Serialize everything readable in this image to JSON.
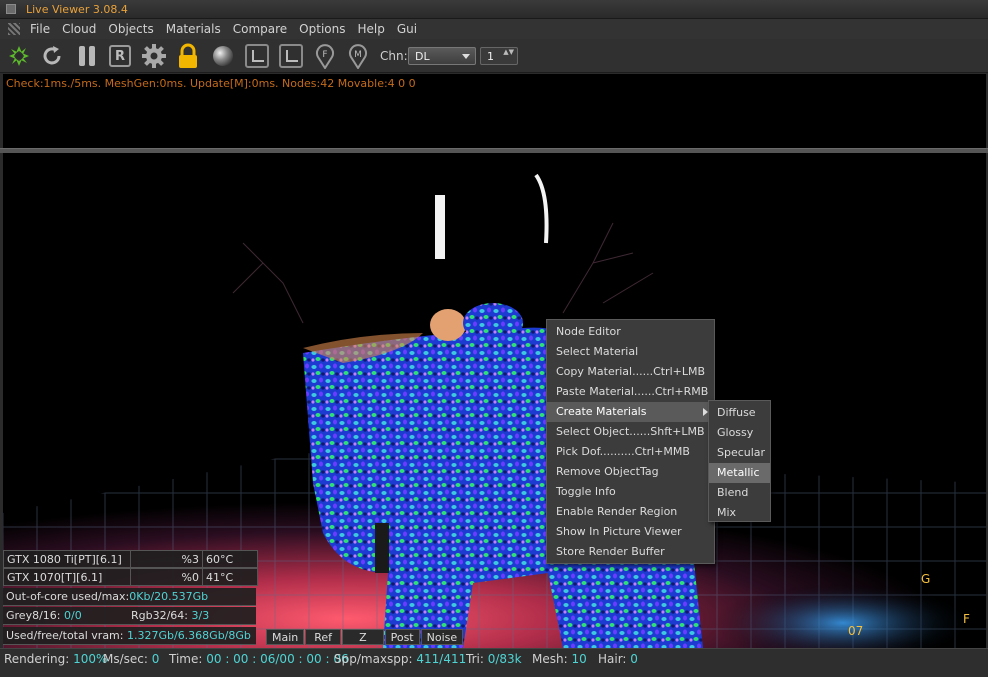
{
  "window": {
    "title": "Live Viewer 3.08.4"
  },
  "menu": [
    "File",
    "Cloud",
    "Objects",
    "Materials",
    "Compare",
    "Options",
    "Help",
    "Gui"
  ],
  "toolbar": {
    "icons": [
      "octane-logo-icon",
      "refresh-icon",
      "pause-icon",
      "restart-icon",
      "gear-icon",
      "lock-icon",
      "material-sphere-icon",
      "region-icon",
      "film-region-icon",
      "focus-pin-icon",
      "material-pin-icon"
    ],
    "restart_glyph": "R",
    "focus_glyph": "F",
    "material_glyph": "M",
    "chn_label": "Chn:",
    "chn_value": "DL",
    "spin_value": "1",
    "spin_glyph": "▲▼",
    "accent": "#e9a23b",
    "octane_green": "#5dbb2b"
  },
  "info": {
    "stats": "Check:1ms./5ms. MeshGen:0ms. Update[M]:0ms. Nodes:42 Movable:4  0 0"
  },
  "gpus": [
    {
      "name": "GTX 1080 Ti[PT][6.1]",
      "usage": "%3",
      "temp": "60°C"
    },
    {
      "name": "GTX 1070[T][6.1]",
      "usage": "%0",
      "temp": "41°C"
    }
  ],
  "overlay": {
    "ooc_label": "Out-of-core used/max:",
    "ooc_value": "0Kb/20.537Gb",
    "grey_label": "Grey8/16: ",
    "grey_value": "0/0",
    "rgb_label": "Rgb32/64: ",
    "rgb_value": "3/3",
    "vram_label": "Used/free/total vram: ",
    "vram_value": "1.327Gb/6.368Gb/8Gb"
  },
  "tabs": [
    "Main",
    "Ref",
    "Z",
    "Post",
    "Noise"
  ],
  "context_menu": [
    "Node Editor",
    "Select Material",
    "Copy Material......Ctrl+LMB",
    "Paste Material......Ctrl+RMB",
    "Create Materials",
    "Select Object......Shft+LMB",
    "Pick Dof..........Ctrl+MMB",
    "Remove ObjectTag",
    "Toggle Info",
    "Enable Render Region",
    "Show In Picture Viewer",
    "Store Render Buffer"
  ],
  "submenu": [
    "Diffuse",
    "Glossy",
    "Specular",
    "Metallic",
    "Blend",
    "Mix"
  ],
  "status": {
    "rendering_label": "Rendering: ",
    "rendering_value": "100%",
    "ms_label": "Ms/sec: ",
    "ms_value": "0",
    "time_label": "Time: ",
    "time_value": "00 : 00 : 06/00 : 00 : 06",
    "spp_label": "Spp/maxspp: ",
    "spp_value": "411/411",
    "tri_label": "Tri: ",
    "tri_value": "0/83k",
    "mesh_label": "Mesh: ",
    "mesh_value": "10",
    "hair_label": "Hair: ",
    "hair_value": "0"
  }
}
